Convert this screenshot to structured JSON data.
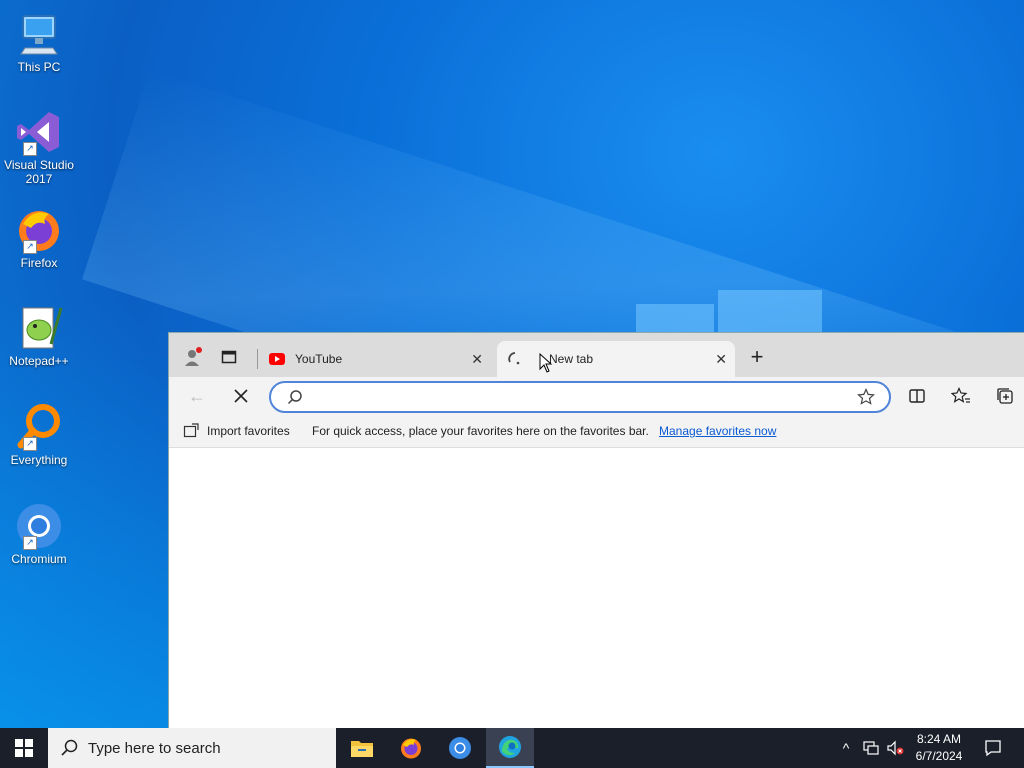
{
  "desktop": {
    "icons": [
      {
        "label": "This PC",
        "icon": "computer-icon"
      },
      {
        "label": "Visual Studio 2017",
        "icon": "visual-studio-icon"
      },
      {
        "label": "Firefox",
        "icon": "firefox-icon"
      },
      {
        "label": "Notepad++",
        "icon": "notepad-plus-plus-icon"
      },
      {
        "label": "Everything",
        "icon": "everything-search-icon"
      },
      {
        "label": "Chromium",
        "icon": "chromium-icon"
      }
    ]
  },
  "browser": {
    "tabs": [
      {
        "title": "YouTube",
        "state": "inactive",
        "icon": "youtube-icon"
      },
      {
        "title": "New tab",
        "state": "active",
        "icon": "loading-spinner-icon"
      }
    ],
    "address_bar": {
      "value": "",
      "placeholder": ""
    },
    "favorites_bar": {
      "import_label": "Import favorites",
      "message": "For quick access, place your favorites here on the favorites bar.",
      "manage_link": "Manage favorites now"
    }
  },
  "taskbar": {
    "search_placeholder": "Type here to search",
    "apps": [
      "file-explorer-icon",
      "firefox-icon",
      "chromium-icon",
      "edge-icon"
    ],
    "clock": {
      "time": "8:24 AM",
      "date": "6/7/2024"
    }
  },
  "colors": {
    "accent": "#4f84d8",
    "link": "#0b5bd3",
    "taskbar": "#1b1f2a",
    "tabstrip": "#dcdcdc"
  }
}
